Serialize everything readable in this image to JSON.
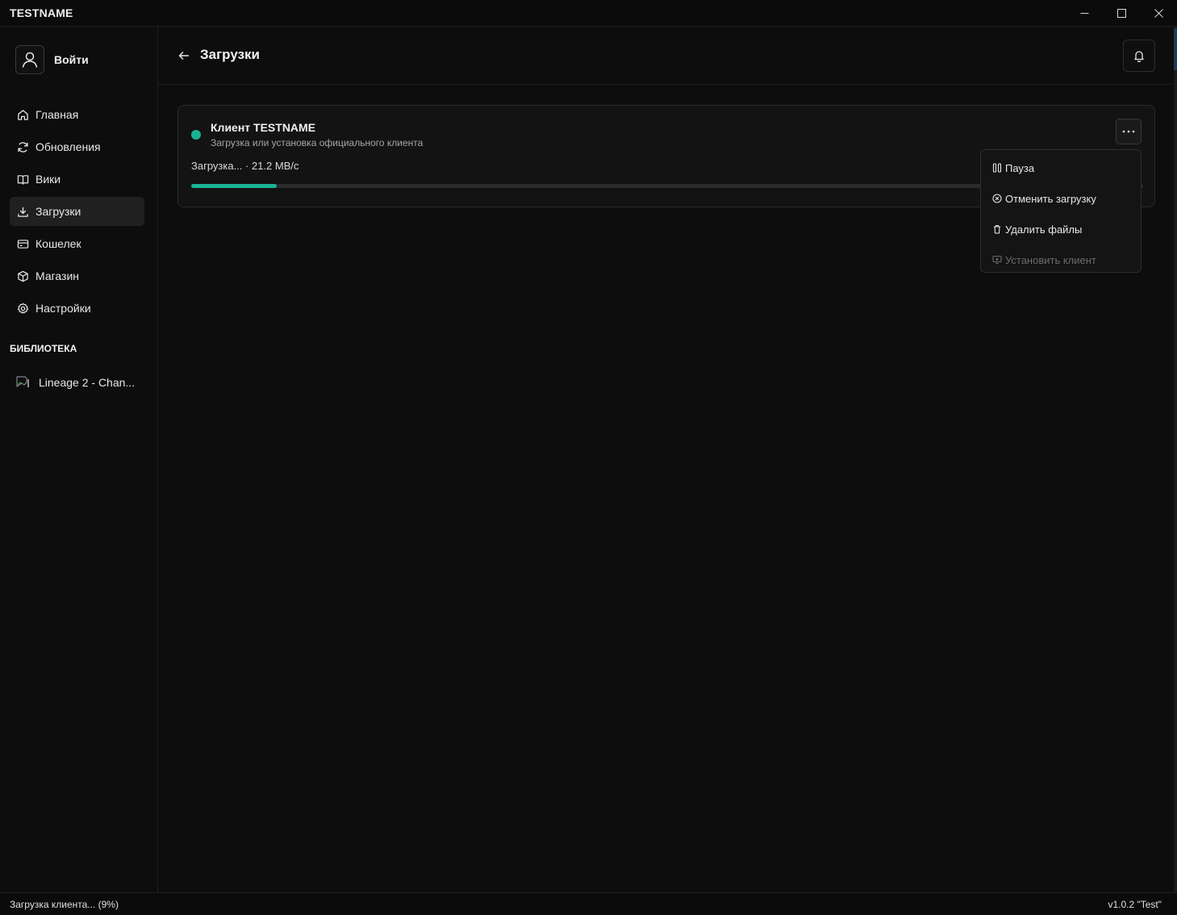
{
  "window": {
    "title": "TESTNAME",
    "controls": [
      "minimize-icon",
      "maximize-icon",
      "close-icon"
    ]
  },
  "sidebar": {
    "login_label": "Войти",
    "items": [
      {
        "label": "Главная",
        "icon": "home-icon"
      },
      {
        "label": "Обновления",
        "icon": "refresh-icon"
      },
      {
        "label": "Вики",
        "icon": "book-icon"
      },
      {
        "label": "Загрузки",
        "icon": "download-icon",
        "active": true
      },
      {
        "label": "Кошелек",
        "icon": "wallet-icon"
      },
      {
        "label": "Магазин",
        "icon": "box-icon"
      },
      {
        "label": "Настройки",
        "icon": "gear-icon"
      }
    ],
    "library_heading": "БИБЛИОТЕКА",
    "library_items": [
      {
        "label": "Lineage 2 - Chan..."
      }
    ]
  },
  "header": {
    "title": "Загрузки"
  },
  "download": {
    "title": "Клиент TESTNAME",
    "subtitle": "Загрузка или установка официального клиента",
    "status": "Загрузка... · 21.2 MB/c",
    "progress": 0.09,
    "status_color": "#19b394"
  },
  "menu": {
    "items": [
      {
        "label": "Пауза",
        "icon": "pause-icon",
        "disabled": false
      },
      {
        "label": "Отменить загрузку",
        "icon": "cancel-circle-icon",
        "disabled": false
      },
      {
        "label": "Удалить файлы",
        "icon": "trash-icon",
        "disabled": false
      },
      {
        "label": "Установить клиент",
        "icon": "install-icon",
        "disabled": true
      }
    ]
  },
  "statusbar": {
    "left": "Загрузка клиента... (9%)",
    "right": "v1.0.2 \"Test\""
  }
}
